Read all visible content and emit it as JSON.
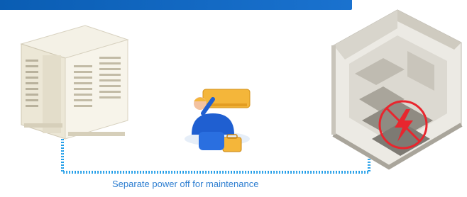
{
  "caption": "Separate power off for maintenance",
  "colors": {
    "banner": "#0a5db3",
    "connector": "#1e9be6",
    "caption": "#2f7fd1",
    "warning": "#e8262e"
  },
  "icons": {
    "outdoor_unit": "outdoor-ac-unit-icon",
    "technician": "technician-repair-icon",
    "room": "room-floorplan-icon",
    "power_off": "lightning-prohibited-icon"
  }
}
